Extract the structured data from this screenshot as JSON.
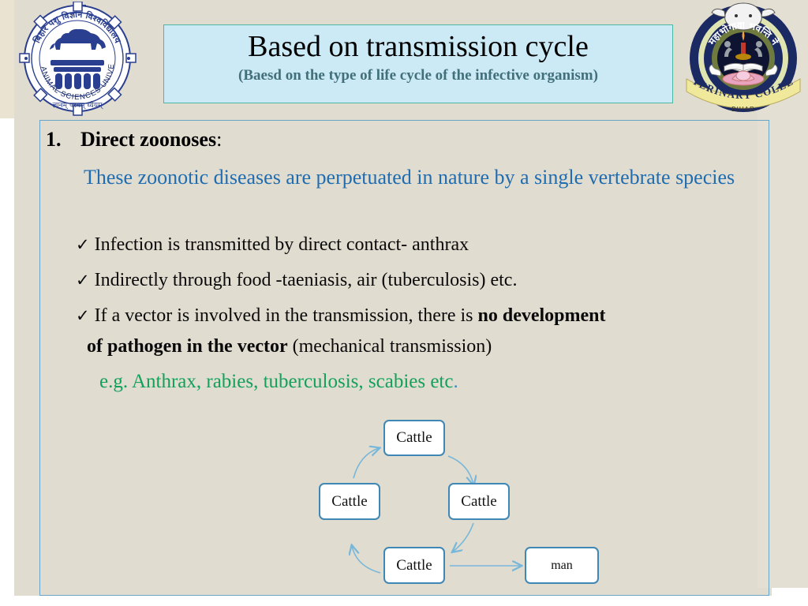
{
  "slide": {
    "title": "Based on transmission cycle",
    "subtitle": "(Baesd on the type of life cycle of the infective organism)",
    "background_color": "#e1dcd0",
    "title_box_color": "#cbeaf6",
    "title_box_border_color": "#4cb8a4",
    "frame_border_color": "#6aa5c8"
  },
  "logos": {
    "left": {
      "name": "Bihar Animal Sciences University",
      "hindi_top": "बिहार पशु विज्ञान विश्वविद्यालय",
      "arc_text": "BIHAR ANIMAL SCIENCES UNIVERSITY",
      "motto": "ज्ञानम् परमम् ध्येयम्",
      "color": "#2a3f8f"
    },
    "right": {
      "name": "Veterinary College Bihar",
      "hindi_top": "महाभोगावा भवन्ति ने",
      "ribbon_left": "VETERINARY",
      "ribbon_right": "COLLEGE",
      "ribbon_center": "BIHAR",
      "color": "#1b2a63"
    }
  },
  "content": {
    "heading_number": "1.",
    "heading_term": "Direct zoonoses",
    "heading_colon": ":",
    "intro": "These zoonotic diseases are perpetuated in nature by a single vertebrate species",
    "intro_color": "#1f6cb0",
    "bullet_marker": "✓",
    "bullets": [
      {
        "text": "Infection is transmitted by direct contact- anthrax"
      },
      {
        "text": "Indirectly through food -taeniasis,  air (tuberculosis) etc."
      }
    ],
    "bullet3": {
      "part1": "If a vector is involved in the transmission, there is ",
      "bold1": "no development",
      "bold2": "of pathogen in the vector",
      "part2": " (mechanical  transmission)"
    },
    "example": {
      "text": "e.g. Anthrax,  rabies, tuberculosis,  scabies etc",
      "trailing_dot": ".",
      "color": "#13a05a"
    }
  },
  "diagram": {
    "node_border_color": "#3f87b4",
    "arrow_color": "#77b7da",
    "nodes": [
      {
        "id": "top",
        "label": "Cattle"
      },
      {
        "id": "right",
        "label": "Cattle"
      },
      {
        "id": "bottom",
        "label": "Cattle"
      },
      {
        "id": "left",
        "label": "Cattle"
      },
      {
        "id": "man",
        "label": "man"
      }
    ]
  }
}
